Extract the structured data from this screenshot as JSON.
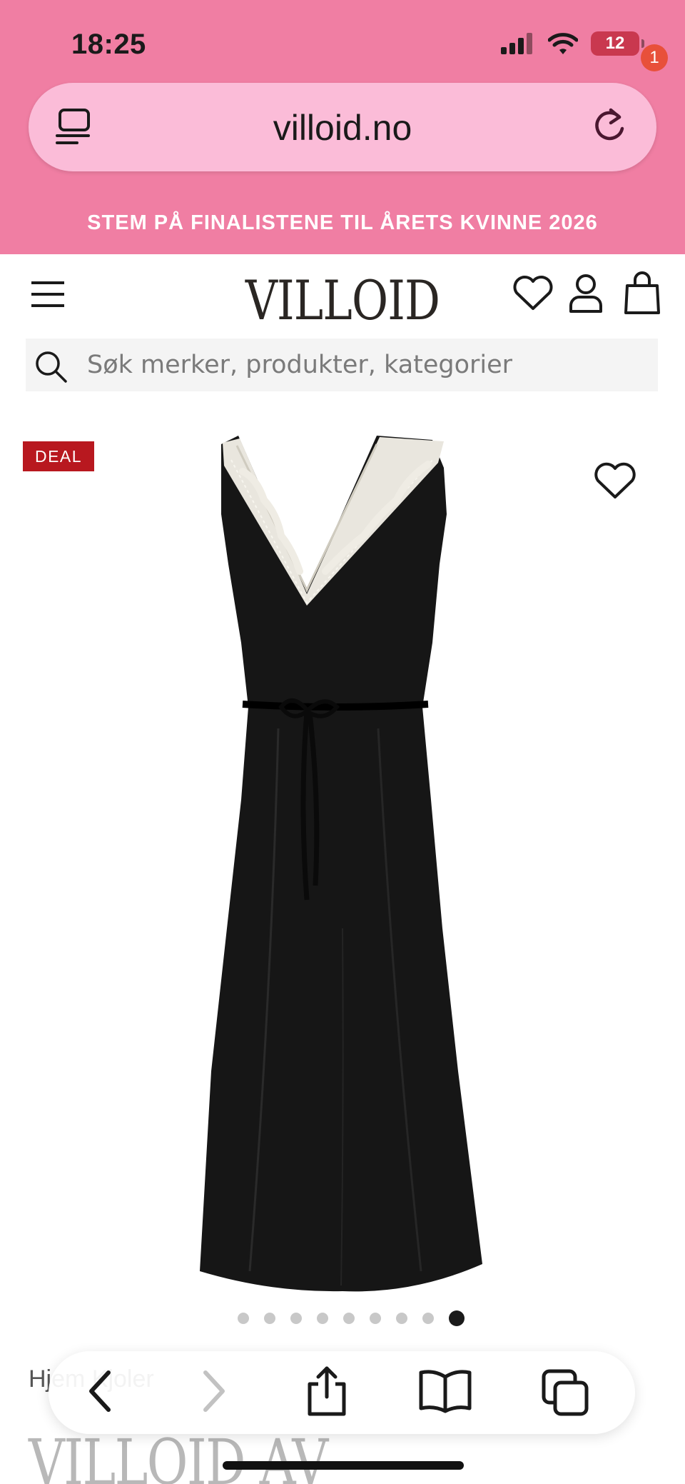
{
  "status_bar": {
    "time": "18:25",
    "battery": "12"
  },
  "browser": {
    "url": "villoid.no"
  },
  "promo_banner": "STEM PÅ FINALISTENE TIL ÅRETS KVINNE 2026",
  "header": {
    "logo": "VILLOID",
    "cart_count": "1"
  },
  "search": {
    "placeholder": "Søk merker, produkter, kategorier"
  },
  "product": {
    "badge": "DEAL",
    "image_count": 9,
    "active_image": 9
  },
  "breadcrumb": {
    "visible_text": "Hjem Kjoler"
  },
  "brand_heading": "VILLOID AV",
  "icons": [
    "tabs-list-icon",
    "reload-icon",
    "menu-icon",
    "heart-icon",
    "user-icon",
    "shopping-bag-icon",
    "search-icon",
    "wishlist-heart-icon",
    "back-icon",
    "forward-icon",
    "share-icon",
    "bookmarks-icon",
    "tabs-icon"
  ],
  "colors": {
    "top_pink": "#f07ea3",
    "url_pill": "#fbbcd8",
    "deal_red": "#b8181f",
    "badge_orange": "#e8503a"
  }
}
